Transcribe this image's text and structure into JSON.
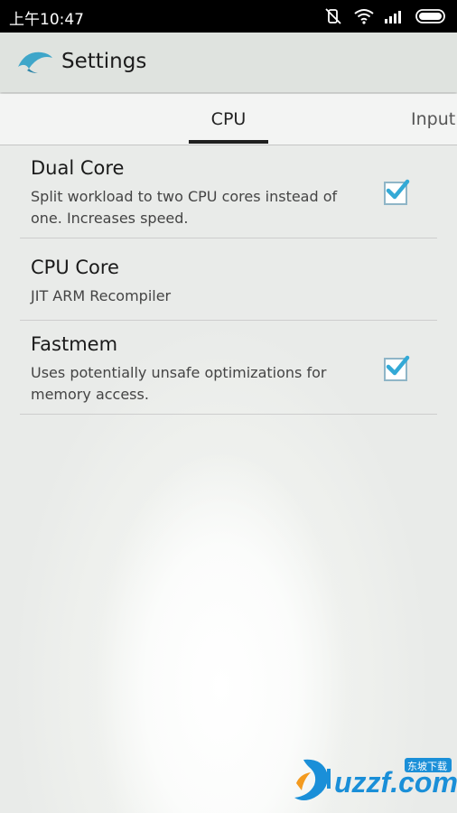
{
  "status_bar": {
    "time": "上午10:47",
    "icons": [
      "mute-icon",
      "wifi-icon",
      "signal-icon",
      "battery-icon"
    ]
  },
  "app_bar": {
    "title": "Settings",
    "logo": "dolphin-logo-icon"
  },
  "tabs": [
    {
      "label": "CPU",
      "selected": true
    },
    {
      "label": "Input",
      "selected": false
    }
  ],
  "settings": [
    {
      "title": "Dual Core",
      "summary": "Split workload to two CPU cores instead of one. Increases speed.",
      "checked": true
    },
    {
      "title": "CPU Core",
      "summary": "JIT ARM Recompiler"
    },
    {
      "title": "Fastmem",
      "summary": "Uses potentially unsafe optimizations for memory access.",
      "checked": true
    }
  ],
  "watermark": {
    "brand": "uzzf.com",
    "tagline": "东坡下载"
  },
  "colors": {
    "checkmark": "#33a9d6",
    "app_bar": "#dfe3df",
    "tab_indicator": "#1f1f1f"
  }
}
